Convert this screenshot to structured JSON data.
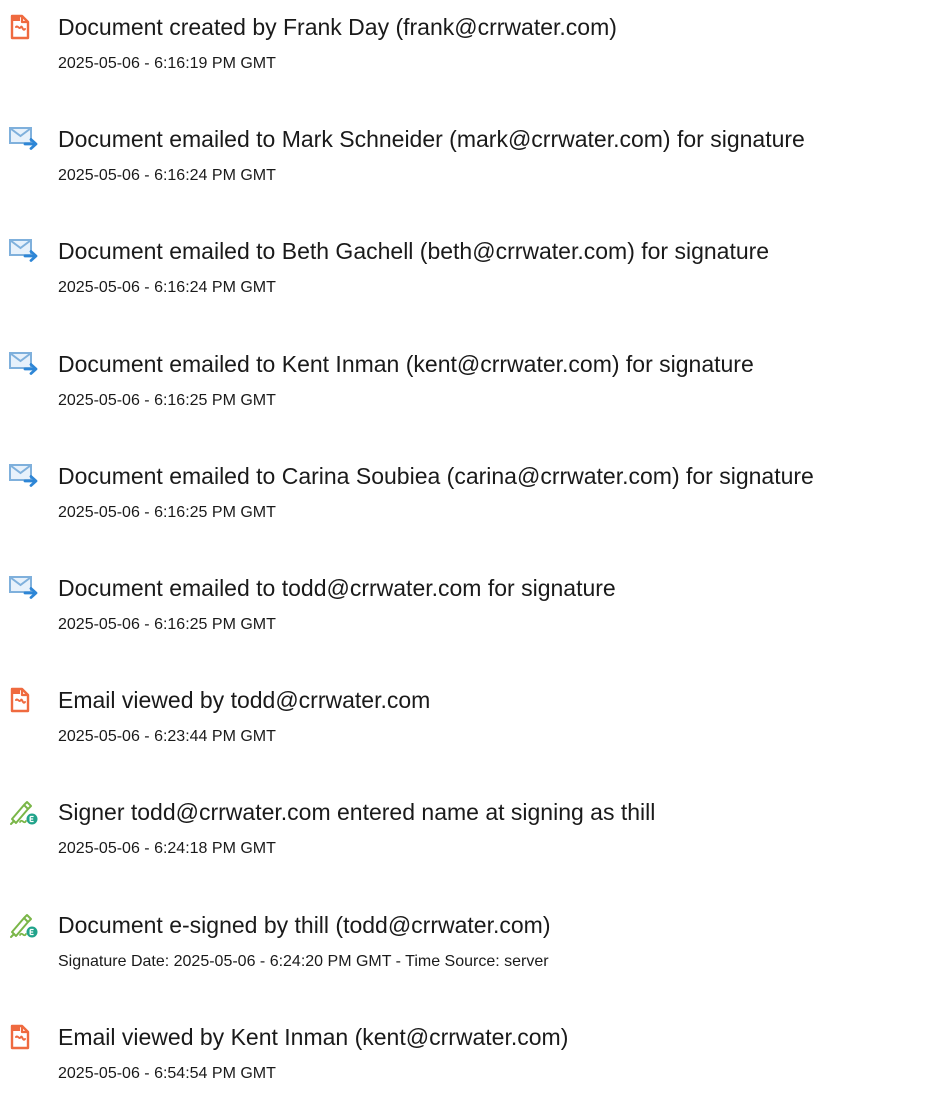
{
  "colors": {
    "doc_icon": "#ef6a3f",
    "email_icon_envelope": "#7fb0dc",
    "email_icon_arrow": "#2e86d6",
    "sign_icon_pen": "#7ab648",
    "sign_icon_badge": "#21a38a",
    "text": "#1a1a1a"
  },
  "events": [
    {
      "icon": "document-icon",
      "text": "Document created by Frank Day (frank@crrwater.com)",
      "timestamp": "2025-05-06 - 6:16:19 PM GMT"
    },
    {
      "icon": "email-sent-icon",
      "text": "Document emailed to Mark Schneider (mark@crrwater.com) for signature",
      "timestamp": "2025-05-06 - 6:16:24 PM GMT"
    },
    {
      "icon": "email-sent-icon",
      "text": "Document emailed to Beth Gachell (beth@crrwater.com) for signature",
      "timestamp": "2025-05-06 - 6:16:24 PM GMT"
    },
    {
      "icon": "email-sent-icon",
      "text": "Document emailed to Kent Inman (kent@crrwater.com) for signature",
      "timestamp": "2025-05-06 - 6:16:25 PM GMT"
    },
    {
      "icon": "email-sent-icon",
      "text": "Document emailed to Carina Soubiea (carina@crrwater.com) for signature",
      "timestamp": "2025-05-06 - 6:16:25 PM GMT"
    },
    {
      "icon": "email-sent-icon",
      "text": "Document emailed to todd@crrwater.com for signature",
      "timestamp": "2025-05-06 - 6:16:25 PM GMT"
    },
    {
      "icon": "document-icon",
      "text": "Email viewed by todd@crrwater.com",
      "timestamp": "2025-05-06 - 6:23:44 PM GMT"
    },
    {
      "icon": "e-sign-icon",
      "text": "Signer todd@crrwater.com entered name at signing as thill",
      "timestamp": "2025-05-06 - 6:24:18 PM GMT"
    },
    {
      "icon": "e-sign-icon",
      "text": "Document e-signed by thill (todd@crrwater.com)",
      "timestamp": "Signature Date: 2025-05-06 - 6:24:20 PM GMT - Time Source: server"
    },
    {
      "icon": "document-icon",
      "text": "Email viewed by Kent Inman (kent@crrwater.com)",
      "timestamp": "2025-05-06 - 6:54:54 PM GMT"
    }
  ]
}
